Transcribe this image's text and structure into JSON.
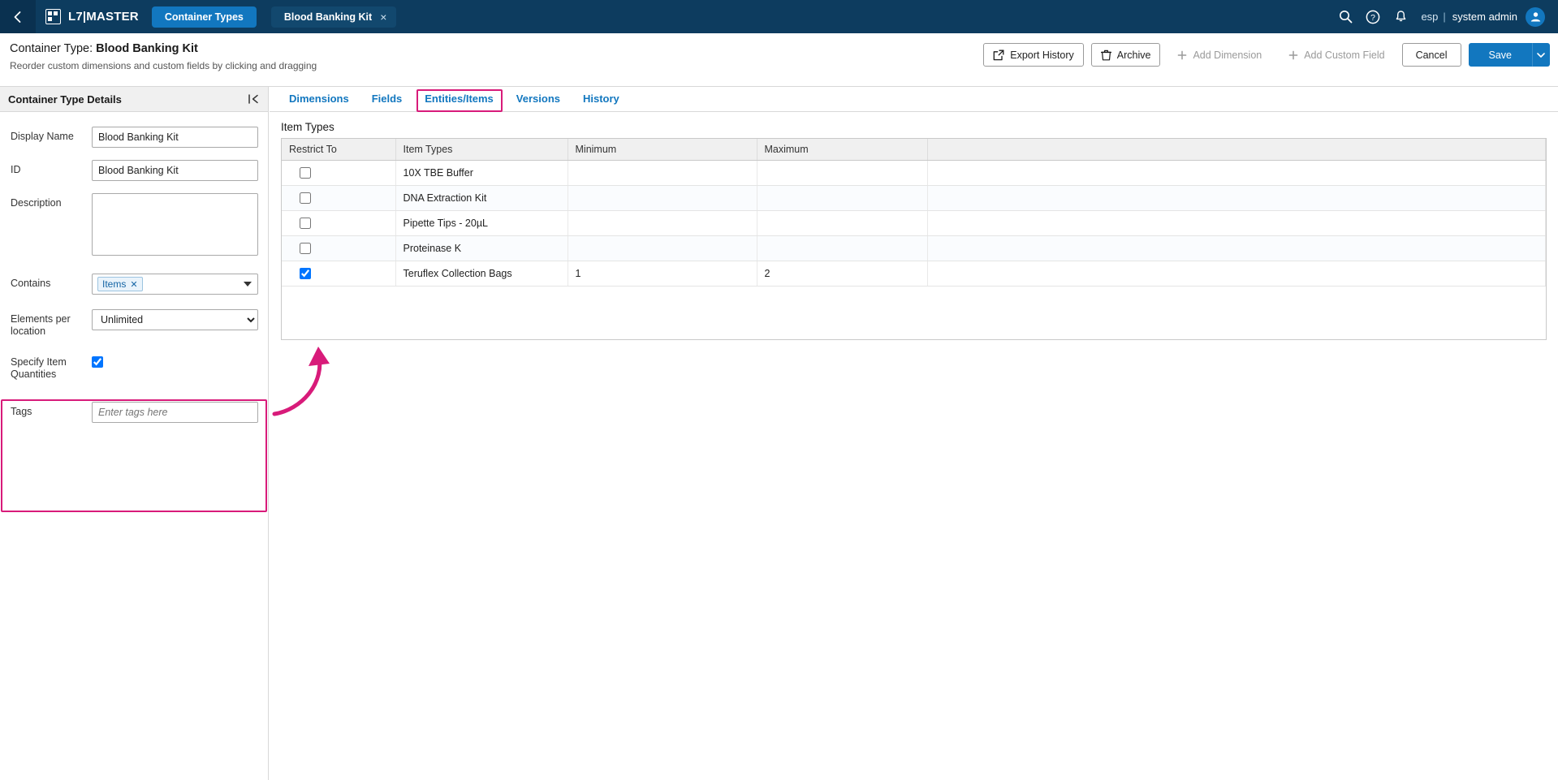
{
  "topnav": {
    "back_icon": "chevron-left-icon",
    "app_logo_icon": "grid-app-icon",
    "app_title": "L7|MASTER",
    "active_module": "Container Types",
    "open_tab_label": "Blood Banking Kit",
    "open_tab_close": "×",
    "search_icon": "search-icon",
    "help_icon": "help-circle-icon",
    "notification_icon": "bell-icon",
    "tenant": "esp",
    "separator": "|",
    "user_name": "system admin",
    "avatar_icon": "user-avatar-icon",
    "bg_color": "#0d3c5f",
    "pill_color": "#1277bf"
  },
  "pageheader": {
    "title_prefix": "Container Type:",
    "title_name": "Blood Banking Kit",
    "subtitle": "Reorder custom dimensions and custom fields by clicking and dragging",
    "export_history_label": "Export History",
    "export_history_icon": "external-link-icon",
    "archive_label": "Archive",
    "archive_icon": "trash-icon",
    "add_dimension_label": "Add Dimension",
    "add_dimension_icon": "plus-icon",
    "add_custom_field_label": "Add Custom Field",
    "add_custom_field_icon": "plus-icon",
    "cancel_label": "Cancel",
    "save_label": "Save",
    "save_caret_icon": "chevron-down-icon",
    "save_color": "#1277bf"
  },
  "details_panel": {
    "header_title": "Container Type Details",
    "collapse_icon": "collapse-panel-icon",
    "fields": {
      "display_name_label": "Display Name",
      "display_name_value": "Blood Banking Kit",
      "id_label": "ID",
      "id_value": "Blood Banking Kit",
      "description_label": "Description",
      "description_value": "",
      "contains_label": "Contains",
      "contains_tag": "Items",
      "contains_tag_remove": "✕",
      "contains_caret_icon": "chevron-down-icon",
      "elements_per_location_label": "Elements per location",
      "elements_per_location_value": "Unlimited",
      "elements_per_location_options": [
        "Unlimited"
      ],
      "specify_item_quantities_label": "Specify Item Quantities",
      "specify_item_quantities_checked": true,
      "tags_label": "Tags",
      "tags_placeholder": "Enter tags here",
      "tags_value": ""
    }
  },
  "main": {
    "tabs": [
      {
        "label": "Dimensions",
        "active": false
      },
      {
        "label": "Fields",
        "active": false
      },
      {
        "label": "Entities/Items",
        "active": true
      },
      {
        "label": "Versions",
        "active": false
      },
      {
        "label": "History",
        "active": false
      }
    ],
    "section_title": "Item Types",
    "table": {
      "columns": [
        "Restrict To",
        "Item Types",
        "Minimum",
        "Maximum",
        ""
      ],
      "rows": [
        {
          "restrict_to": false,
          "item_type": "10X TBE Buffer",
          "minimum": "",
          "maximum": ""
        },
        {
          "restrict_to": false,
          "item_type": "DNA Extraction Kit",
          "minimum": "",
          "maximum": ""
        },
        {
          "restrict_to": false,
          "item_type": "Pipette Tips - 20µL",
          "minimum": "",
          "maximum": ""
        },
        {
          "restrict_to": false,
          "item_type": "Proteinase K",
          "minimum": "",
          "maximum": ""
        },
        {
          "restrict_to": true,
          "item_type": "Teruflex Collection Bags",
          "minimum": "1",
          "maximum": "2"
        }
      ]
    }
  },
  "annotations": {
    "color": "#d81b7a",
    "highlight_tab": "Entities/Items",
    "highlight_group": "Contains / Elements per location / Specify Item Quantities",
    "arrow_target": "Teruflex Collection Bags row"
  }
}
